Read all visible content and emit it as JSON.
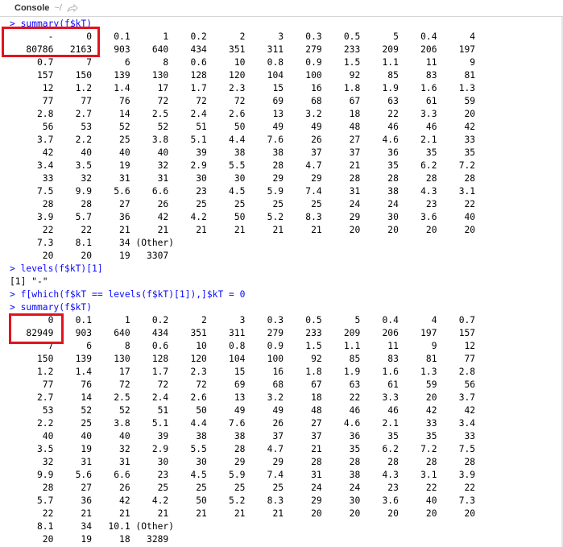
{
  "header": {
    "title": "Console",
    "path": "~/"
  },
  "console": {
    "lines": [
      {
        "type": "cmd",
        "text": "> summary(f$kT)"
      },
      {
        "type": "out",
        "text": "       -      0    0.1      1    0.2      2      3    0.3    0.5      5    0.4      4"
      },
      {
        "type": "out",
        "text": "   80786   2163    903    640    434    351    311    279    233    209    206    197"
      },
      {
        "type": "out",
        "text": "     0.7      7      6      8    0.6     10    0.8    0.9    1.5    1.1     11      9"
      },
      {
        "type": "out",
        "text": "     157    150    139    130    128    120    104    100     92     85     83     81"
      },
      {
        "type": "out",
        "text": "      12    1.2    1.4     17    1.7    2.3     15     16    1.8    1.9    1.6    1.3"
      },
      {
        "type": "out",
        "text": "      77     77     76     72     72     72     69     68     67     63     61     59"
      },
      {
        "type": "out",
        "text": "     2.8    2.7     14    2.5    2.4    2.6     13    3.2     18     22    3.3     20"
      },
      {
        "type": "out",
        "text": "      56     53     52     52     51     50     49     49     48     46     46     42"
      },
      {
        "type": "out",
        "text": "     3.7    2.2     25    3.8    5.1    4.4    7.6     26     27    4.6    2.1     33"
      },
      {
        "type": "out",
        "text": "      42     40     40     40     39     38     38     37     37     36     35     35"
      },
      {
        "type": "out",
        "text": "     3.4    3.5     19     32    2.9    5.5     28    4.7     21     35    6.2    7.2"
      },
      {
        "type": "out",
        "text": "      33     32     31     31     30     30     29     29     28     28     28     28"
      },
      {
        "type": "out",
        "text": "     7.5    9.9    5.6    6.6     23    4.5    5.9    7.4     31     38    4.3    3.1"
      },
      {
        "type": "out",
        "text": "      28     28     27     26     25     25     25     25     24     24     23     22"
      },
      {
        "type": "out",
        "text": "     3.9    5.7     36     42    4.2     50    5.2    8.3     29     30    3.6     40"
      },
      {
        "type": "out",
        "text": "      22     22     21     21     21     21     21     21     20     20     20     20"
      },
      {
        "type": "out",
        "text": "     7.3    8.1     34 (Other)"
      },
      {
        "type": "out",
        "text": "      20     20     19   3307"
      },
      {
        "type": "cmd",
        "text": "> levels(f$kT)[1]"
      },
      {
        "type": "out",
        "text": "[1] \"-\""
      },
      {
        "type": "cmd",
        "text": "> f[which(f$kT == levels(f$kT)[1]),]$kT = 0"
      },
      {
        "type": "cmd",
        "text": "> summary(f$kT)"
      },
      {
        "type": "out",
        "text": "       0    0.1      1    0.2      2      3    0.3    0.5      5    0.4      4    0.7"
      },
      {
        "type": "out",
        "text": "   82949    903    640    434    351    311    279    233    209    206    197    157"
      },
      {
        "type": "out",
        "text": "       7      6      8    0.6     10    0.8    0.9    1.5    1.1     11      9     12"
      },
      {
        "type": "out",
        "text": "     150    139    130    128    120    104    100     92     85     83     81     77"
      },
      {
        "type": "out",
        "text": "     1.2    1.4     17    1.7    2.3     15     16    1.8    1.9    1.6    1.3    2.8"
      },
      {
        "type": "out",
        "text": "      77     76     72     72     72     69     68     67     63     61     59     56"
      },
      {
        "type": "out",
        "text": "     2.7     14    2.5    2.4    2.6     13    3.2     18     22    3.3     20    3.7"
      },
      {
        "type": "out",
        "text": "      53     52     52     51     50     49     49     48     46     46     42     42"
      },
      {
        "type": "out",
        "text": "     2.2     25    3.8    5.1    4.4    7.6     26     27    4.6    2.1     33    3.4"
      },
      {
        "type": "out",
        "text": "      40     40     40     39     38     38     37     37     36     35     35     33"
      },
      {
        "type": "out",
        "text": "     3.5     19     32    2.9    5.5     28    4.7     21     35    6.2    7.2    7.5"
      },
      {
        "type": "out",
        "text": "      32     31     31     30     30     29     29     28     28     28     28     28"
      },
      {
        "type": "out",
        "text": "     9.9    5.6    6.6     23    4.5    5.9    7.4     31     38    4.3    3.1    3.9"
      },
      {
        "type": "out",
        "text": "      28     27     26     25     25     25     25     24     24     23     22     22"
      },
      {
        "type": "out",
        "text": "     5.7     36     42    4.2     50    5.2    8.3     29     30    3.6     40    7.3"
      },
      {
        "type": "out",
        "text": "      22     21     21     21     21     21     21     20     20     20     20     20"
      },
      {
        "type": "out",
        "text": "     8.1     34   10.1 (Other)"
      },
      {
        "type": "out",
        "text": "      20     19     18   3289"
      }
    ]
  },
  "colors": {
    "command": "#0a0aff",
    "output": "#000000",
    "highlight": "#e0141e"
  }
}
